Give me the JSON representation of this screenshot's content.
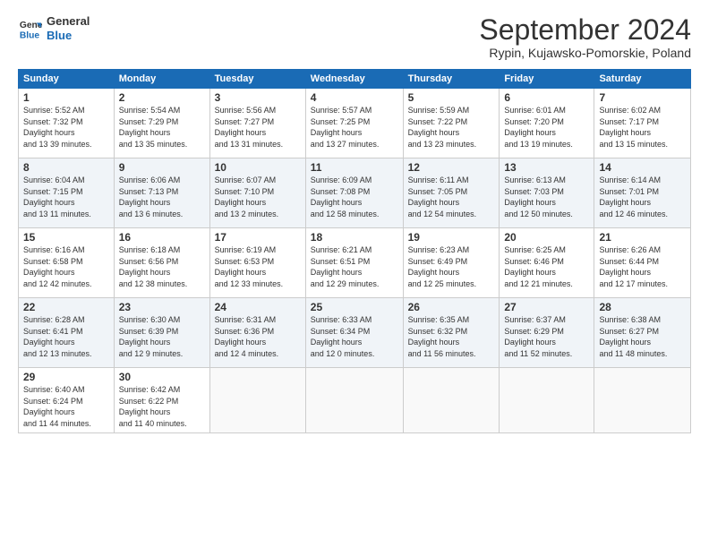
{
  "header": {
    "logo_general": "General",
    "logo_blue": "Blue",
    "month": "September 2024",
    "location": "Rypin, Kujawsko-Pomorskie, Poland"
  },
  "days_of_week": [
    "Sunday",
    "Monday",
    "Tuesday",
    "Wednesday",
    "Thursday",
    "Friday",
    "Saturday"
  ],
  "weeks": [
    [
      {
        "day": "1",
        "sunrise": "5:52 AM",
        "sunset": "7:32 PM",
        "daylight": "13 hours and 39 minutes."
      },
      {
        "day": "2",
        "sunrise": "5:54 AM",
        "sunset": "7:29 PM",
        "daylight": "13 hours and 35 minutes."
      },
      {
        "day": "3",
        "sunrise": "5:56 AM",
        "sunset": "7:27 PM",
        "daylight": "13 hours and 31 minutes."
      },
      {
        "day": "4",
        "sunrise": "5:57 AM",
        "sunset": "7:25 PM",
        "daylight": "13 hours and 27 minutes."
      },
      {
        "day": "5",
        "sunrise": "5:59 AM",
        "sunset": "7:22 PM",
        "daylight": "13 hours and 23 minutes."
      },
      {
        "day": "6",
        "sunrise": "6:01 AM",
        "sunset": "7:20 PM",
        "daylight": "13 hours and 19 minutes."
      },
      {
        "day": "7",
        "sunrise": "6:02 AM",
        "sunset": "7:17 PM",
        "daylight": "13 hours and 15 minutes."
      }
    ],
    [
      {
        "day": "8",
        "sunrise": "6:04 AM",
        "sunset": "7:15 PM",
        "daylight": "13 hours and 11 minutes."
      },
      {
        "day": "9",
        "sunrise": "6:06 AM",
        "sunset": "7:13 PM",
        "daylight": "13 hours and 6 minutes."
      },
      {
        "day": "10",
        "sunrise": "6:07 AM",
        "sunset": "7:10 PM",
        "daylight": "13 hours and 2 minutes."
      },
      {
        "day": "11",
        "sunrise": "6:09 AM",
        "sunset": "7:08 PM",
        "daylight": "12 hours and 58 minutes."
      },
      {
        "day": "12",
        "sunrise": "6:11 AM",
        "sunset": "7:05 PM",
        "daylight": "12 hours and 54 minutes."
      },
      {
        "day": "13",
        "sunrise": "6:13 AM",
        "sunset": "7:03 PM",
        "daylight": "12 hours and 50 minutes."
      },
      {
        "day": "14",
        "sunrise": "6:14 AM",
        "sunset": "7:01 PM",
        "daylight": "12 hours and 46 minutes."
      }
    ],
    [
      {
        "day": "15",
        "sunrise": "6:16 AM",
        "sunset": "6:58 PM",
        "daylight": "12 hours and 42 minutes."
      },
      {
        "day": "16",
        "sunrise": "6:18 AM",
        "sunset": "6:56 PM",
        "daylight": "12 hours and 38 minutes."
      },
      {
        "day": "17",
        "sunrise": "6:19 AM",
        "sunset": "6:53 PM",
        "daylight": "12 hours and 33 minutes."
      },
      {
        "day": "18",
        "sunrise": "6:21 AM",
        "sunset": "6:51 PM",
        "daylight": "12 hours and 29 minutes."
      },
      {
        "day": "19",
        "sunrise": "6:23 AM",
        "sunset": "6:49 PM",
        "daylight": "12 hours and 25 minutes."
      },
      {
        "day": "20",
        "sunrise": "6:25 AM",
        "sunset": "6:46 PM",
        "daylight": "12 hours and 21 minutes."
      },
      {
        "day": "21",
        "sunrise": "6:26 AM",
        "sunset": "6:44 PM",
        "daylight": "12 hours and 17 minutes."
      }
    ],
    [
      {
        "day": "22",
        "sunrise": "6:28 AM",
        "sunset": "6:41 PM",
        "daylight": "12 hours and 13 minutes."
      },
      {
        "day": "23",
        "sunrise": "6:30 AM",
        "sunset": "6:39 PM",
        "daylight": "12 hours and 9 minutes."
      },
      {
        "day": "24",
        "sunrise": "6:31 AM",
        "sunset": "6:36 PM",
        "daylight": "12 hours and 4 minutes."
      },
      {
        "day": "25",
        "sunrise": "6:33 AM",
        "sunset": "6:34 PM",
        "daylight": "12 hours and 0 minutes."
      },
      {
        "day": "26",
        "sunrise": "6:35 AM",
        "sunset": "6:32 PM",
        "daylight": "11 hours and 56 minutes."
      },
      {
        "day": "27",
        "sunrise": "6:37 AM",
        "sunset": "6:29 PM",
        "daylight": "11 hours and 52 minutes."
      },
      {
        "day": "28",
        "sunrise": "6:38 AM",
        "sunset": "6:27 PM",
        "daylight": "11 hours and 48 minutes."
      }
    ],
    [
      {
        "day": "29",
        "sunrise": "6:40 AM",
        "sunset": "6:24 PM",
        "daylight": "11 hours and 44 minutes."
      },
      {
        "day": "30",
        "sunrise": "6:42 AM",
        "sunset": "6:22 PM",
        "daylight": "11 hours and 40 minutes."
      },
      null,
      null,
      null,
      null,
      null
    ]
  ]
}
